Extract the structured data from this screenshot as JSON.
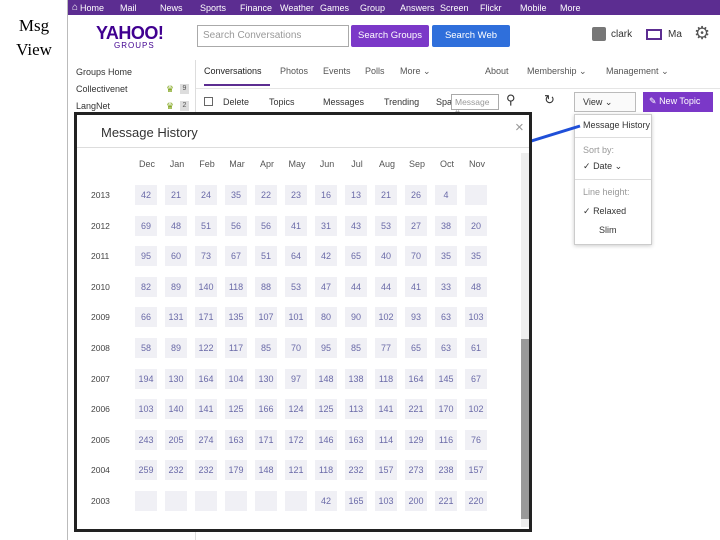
{
  "slide_label": "Msg View",
  "topbar": {
    "items": [
      "Home",
      "Mail",
      "News",
      "Sports",
      "Finance",
      "Weather",
      "Games",
      "Group",
      "Answers",
      "Screen",
      "Flickr",
      "Mobile",
      "More"
    ]
  },
  "header": {
    "logo": "YAHOO!",
    "logo_sub": "GROUPS",
    "search_placeholder": "Search Conversations",
    "search_groups": "Search Groups",
    "search_web": "Search Web",
    "user_name": "clark",
    "mail_label": "Ma"
  },
  "sidebar": {
    "items": [
      {
        "label": "Groups Home",
        "count": ""
      },
      {
        "label": "Collectivenet",
        "count": "9"
      },
      {
        "label": "LangNet",
        "count": "2"
      }
    ]
  },
  "tabs": [
    "Conversations",
    "Photos",
    "Events",
    "Polls",
    "More",
    "About",
    "Membership",
    "Management"
  ],
  "toolbar": {
    "delete": "Delete",
    "topics": "Topics",
    "messages": "Messages",
    "trending": "Trending",
    "spam": "Spa",
    "msg_placeholder": "Message #",
    "view": "View",
    "new_topic": "New Topic"
  },
  "dropdown": {
    "title": "Message History",
    "sort_by": "Sort by:",
    "date": "Date",
    "line_height": "Line height:",
    "relaxed": "Relaxed",
    "slim": "Slim"
  },
  "modal": {
    "title": "Message History",
    "close": "×"
  },
  "history": {
    "months": [
      "Dec",
      "Jan",
      "Feb",
      "Mar",
      "Apr",
      "May",
      "Jun",
      "Jul",
      "Aug",
      "Sep",
      "Oct",
      "Nov"
    ],
    "rows": [
      {
        "year": "2013",
        "values": [
          "42",
          "21",
          "24",
          "35",
          "22",
          "23",
          "16",
          "13",
          "21",
          "26",
          "4",
          ""
        ]
      },
      {
        "year": "2012",
        "values": [
          "69",
          "48",
          "51",
          "56",
          "56",
          "41",
          "31",
          "43",
          "53",
          "27",
          "38",
          "20"
        ]
      },
      {
        "year": "2011",
        "values": [
          "95",
          "60",
          "73",
          "67",
          "51",
          "64",
          "42",
          "65",
          "40",
          "70",
          "35",
          "35"
        ]
      },
      {
        "year": "2010",
        "values": [
          "82",
          "89",
          "140",
          "118",
          "88",
          "53",
          "47",
          "44",
          "44",
          "41",
          "33",
          "48"
        ]
      },
      {
        "year": "2009",
        "values": [
          "66",
          "131",
          "171",
          "135",
          "107",
          "101",
          "80",
          "90",
          "102",
          "93",
          "63",
          "103"
        ]
      },
      {
        "year": "2008",
        "values": [
          "58",
          "89",
          "122",
          "117",
          "85",
          "70",
          "95",
          "85",
          "77",
          "65",
          "63",
          "61"
        ]
      },
      {
        "year": "2007",
        "values": [
          "194",
          "130",
          "164",
          "104",
          "130",
          "97",
          "148",
          "138",
          "118",
          "164",
          "145",
          "67"
        ]
      },
      {
        "year": "2006",
        "values": [
          "103",
          "140",
          "141",
          "125",
          "166",
          "124",
          "125",
          "113",
          "141",
          "221",
          "170",
          "102"
        ]
      },
      {
        "year": "2005",
        "values": [
          "243",
          "205",
          "274",
          "163",
          "171",
          "172",
          "146",
          "163",
          "114",
          "129",
          "116",
          "76"
        ]
      },
      {
        "year": "2004",
        "values": [
          "259",
          "232",
          "232",
          "179",
          "148",
          "121",
          "118",
          "232",
          "157",
          "273",
          "238",
          "157"
        ]
      },
      {
        "year": "2003",
        "values": [
          "",
          "",
          "",
          "",
          "",
          "",
          "42",
          "165",
          "103",
          "200",
          "221",
          "220"
        ]
      }
    ]
  },
  "colors": {
    "brand_purple": "#5c2d91",
    "button_purple": "#7b38c8",
    "button_blue": "#2f6fdb",
    "arrow_blue": "#1f4fd8",
    "cell_text": "#6a6aa8"
  }
}
